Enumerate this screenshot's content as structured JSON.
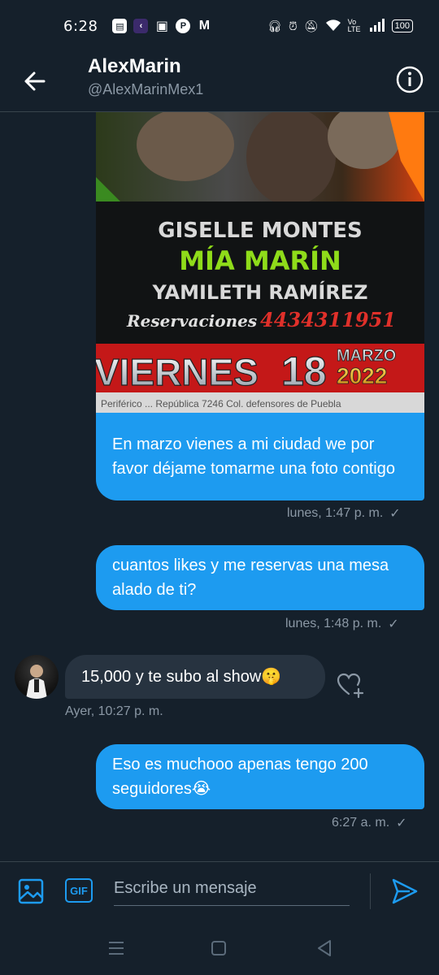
{
  "status": {
    "time": "6:28",
    "network": "Vo LTE",
    "battery": "100"
  },
  "header": {
    "name": "AlexMarin",
    "handle": "@AlexMarinMex1"
  },
  "poster": {
    "line1": "GISELLE MONTES",
    "line2": "MÍA MARÍN",
    "line3": "YAMILETH RAMÍREZ",
    "reservations_label": "Reservaciones",
    "reservations_phone": "4434311951",
    "day": "VIERNES",
    "date": "18",
    "month": "MARZO",
    "year": "2022",
    "address": "Periférico ... República 7246 Col. defensores de Puebla"
  },
  "messages": [
    {
      "text": "En marzo vienes a mi ciudad we por favor déjame tomarme una foto contigo",
      "time": "lunes, 1:47 p. m."
    },
    {
      "text": "cuantos likes y me reservas una mesa alado de ti?",
      "time": "lunes, 1:48 p. m."
    },
    {
      "text": "15,000 y te subo al show🤫",
      "time": "Ayer, 10:27 p. m."
    },
    {
      "text": "Eso es muchooo apenas tengo 200 seguidores😭",
      "time": "6:27 a. m."
    }
  ],
  "composer": {
    "gif_label": "GIF",
    "placeholder": "Escribe un mensaje"
  },
  "colors": {
    "background": "#15202b",
    "accent": "#1d9bf0",
    "received_bubble": "#273340",
    "muted_text": "#8b98a5"
  }
}
